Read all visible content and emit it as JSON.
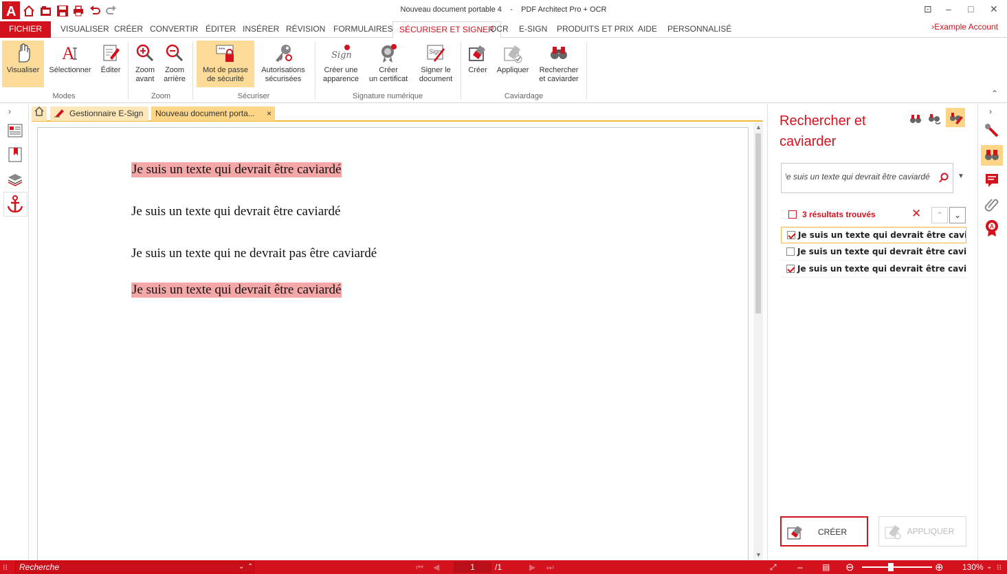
{
  "window": {
    "title": "Nouveau document portable 4",
    "separator": "-",
    "app_name": "PDF Architect Pro + OCR"
  },
  "quick_access": [
    "app-logo-icon",
    "home-icon",
    "folder-icon",
    "save-icon",
    "print-icon",
    "undo-icon",
    "redo-icon"
  ],
  "menu": {
    "fichier": "FICHIER",
    "tabs": [
      "VISUALISER",
      "CRÉER",
      "CONVERTIR",
      "ÉDITER",
      "INSÉRER",
      "RÉVISION",
      "FORMULAIRES",
      "SÉCURISER ET SIGNER",
      "OCR",
      "E-SIGN",
      "PRODUITS ET PRIX",
      "AIDE",
      "PERSONNALISÉ"
    ],
    "active_tab": "SÉCURISER ET SIGNER",
    "account": "Example Account",
    "account_arrow": "›"
  },
  "ribbon": {
    "modes": {
      "label": "Modes",
      "visualiser": "Visualiser",
      "selectionner": "Sélectionner",
      "editer": "Éditer"
    },
    "zoom": {
      "label": "Zoom",
      "zoom_in_1": "Zoom",
      "zoom_in_2": "avant",
      "zoom_out_1": "Zoom",
      "zoom_out_2": "arrière"
    },
    "securiser": {
      "label": "Sécuriser",
      "password_1": "Mot de passe",
      "password_2": "de sécurité",
      "perms_1": "Autorisations",
      "perms_2": "sécurisées"
    },
    "signature": {
      "label": "Signature numérique",
      "appearance_1": "Créer une",
      "appearance_2": "apparence",
      "cert_1": "Créer",
      "cert_2": "un certificat",
      "sign_1": "Signer le",
      "sign_2": "document"
    },
    "caviardage": {
      "label": "Caviardage",
      "creer": "Créer",
      "appliquer": "Appliquer",
      "search_1": "Rechercher",
      "search_2": "et caviarder"
    }
  },
  "doc_tabs": {
    "esign": "Gestionnaire E-Sign",
    "document": "Nouveau document porta...",
    "close": "×"
  },
  "document": {
    "lines": [
      {
        "text": "Je suis un texte qui devrait être caviardé",
        "highlighted": true
      },
      {
        "text": "Je suis un texte qui devrait être caviardé",
        "highlighted": false
      },
      {
        "text": "Je suis un texte qui ne devrait pas être caviardé",
        "highlighted": false
      },
      {
        "text": "Je suis un texte qui devrait être caviardé",
        "highlighted": true
      }
    ]
  },
  "panel": {
    "title": "Rechercher et caviarder",
    "search_value": "Je suis un texte qui devrait être caviardé",
    "results_count": "3 résultats trouvés",
    "results": [
      {
        "text": "Je suis un texte qui devrait être caviardé",
        "checked": true
      },
      {
        "text": "Je suis un texte qui devrait être caviardé",
        "checked": false
      },
      {
        "text": "Je suis un texte qui devrait être caviardé",
        "checked": true
      }
    ],
    "create_button": "CRÉER",
    "apply_button": "APPLIQUER"
  },
  "status": {
    "search_placeholder": "Recherche",
    "page_current": "1",
    "page_total": "/1",
    "zoom": "130%"
  },
  "colors": {
    "accent": "#d3121e",
    "highlight": "#f5a6a6",
    "selected": "#fddc99"
  }
}
